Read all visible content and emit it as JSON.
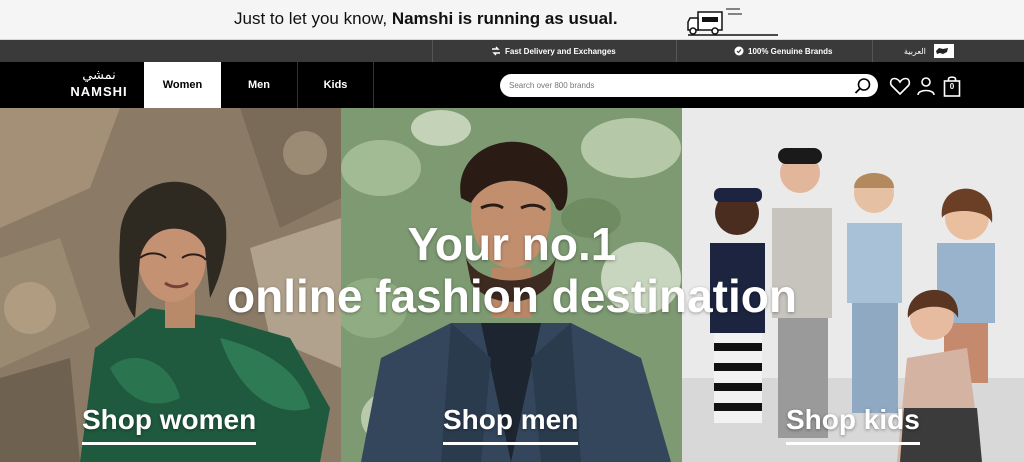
{
  "announcement": {
    "prefix": "Just to let you know, ",
    "highlight": "Namshi is running as usual."
  },
  "utility_bar": {
    "delivery": "Fast Delivery and Exchanges",
    "genuine": "100% Genuine Brands",
    "language": "العربية"
  },
  "header": {
    "logo_ar": "نمشي",
    "logo_en": "NAMSHI",
    "tabs": [
      "Women",
      "Men",
      "Kids"
    ],
    "search_placeholder": "Search over 800 brands",
    "bag_count": "0"
  },
  "hero": {
    "title_line1": "Your no.1",
    "title_line2": "online fashion destination",
    "shop_women": "Shop women",
    "shop_men": "Shop men",
    "shop_kids": "Shop kids"
  },
  "colors": {
    "nav_bg": "#000000",
    "util_bg": "#3a3a3a",
    "announce_bg": "#f5f5f5"
  }
}
